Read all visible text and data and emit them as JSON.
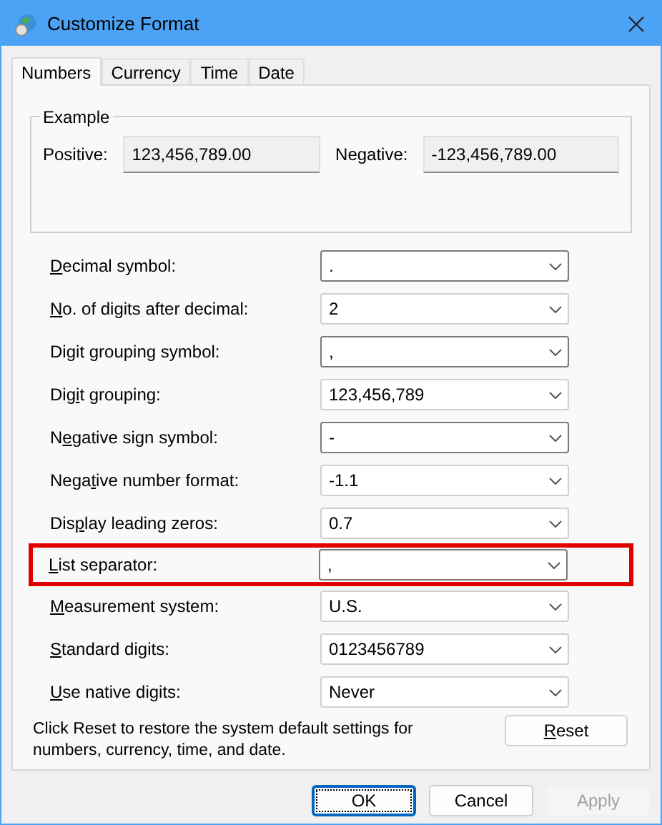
{
  "window": {
    "title": "Customize Format"
  },
  "tabs": [
    {
      "label": "Numbers",
      "selected": true
    },
    {
      "label": "Currency",
      "selected": false
    },
    {
      "label": "Time",
      "selected": false
    },
    {
      "label": "Date",
      "selected": false
    }
  ],
  "example": {
    "title": "Example",
    "positive_label": "Positive:",
    "positive_value": "123,456,789.00",
    "negative_label": "Negative:",
    "negative_value": "-123,456,789.00"
  },
  "settings": [
    {
      "access_key": "D",
      "label_after": "ecimal symbol:",
      "value": ".",
      "kind": "editable",
      "highlighted": false
    },
    {
      "access_key": "N",
      "label_after": "o. of digits after decimal:",
      "value": "2",
      "kind": "list",
      "highlighted": false
    },
    {
      "label_before": "Di",
      "access_key": "g",
      "label_after": "it grouping symbol:",
      "value": ",",
      "kind": "editable",
      "highlighted": false
    },
    {
      "label_before": "Dig",
      "access_key": "i",
      "label_after": "t grouping:",
      "value": "123,456,789",
      "kind": "list",
      "highlighted": false
    },
    {
      "label_before": "N",
      "access_key": "e",
      "label_after": "gative sign symbol:",
      "value": "-",
      "kind": "editable",
      "highlighted": false
    },
    {
      "label_before": "Nega",
      "access_key": "t",
      "label_after": "ive number format:",
      "value": "-1.1",
      "kind": "list",
      "highlighted": false
    },
    {
      "label_before": "Dis",
      "access_key": "p",
      "label_after": "lay leading zeros:",
      "value": "0.7",
      "kind": "list",
      "highlighted": false
    },
    {
      "access_key": "L",
      "label_after": "ist separator:",
      "value": ",",
      "kind": "editable",
      "highlighted": true
    },
    {
      "access_key": "M",
      "label_after": "easurement system:",
      "value": "U.S.",
      "kind": "list",
      "highlighted": false
    },
    {
      "access_key": "S",
      "label_after": "tandard digits:",
      "value": "0123456789",
      "kind": "list",
      "highlighted": false
    },
    {
      "access_key": "U",
      "label_after": "se native digits:",
      "value": "Never",
      "kind": "list",
      "highlighted": false
    }
  ],
  "reset_note": "Click Reset to restore the system default settings for numbers, currency, time, and date.",
  "reset_button": {
    "access_key": "R",
    "label_after": "eset"
  },
  "buttons": [
    {
      "label": "OK",
      "default": true,
      "disabled": false
    },
    {
      "label": "Cancel",
      "default": false,
      "disabled": false
    },
    {
      "label": "Apply",
      "default": false,
      "disabled": true
    }
  ]
}
